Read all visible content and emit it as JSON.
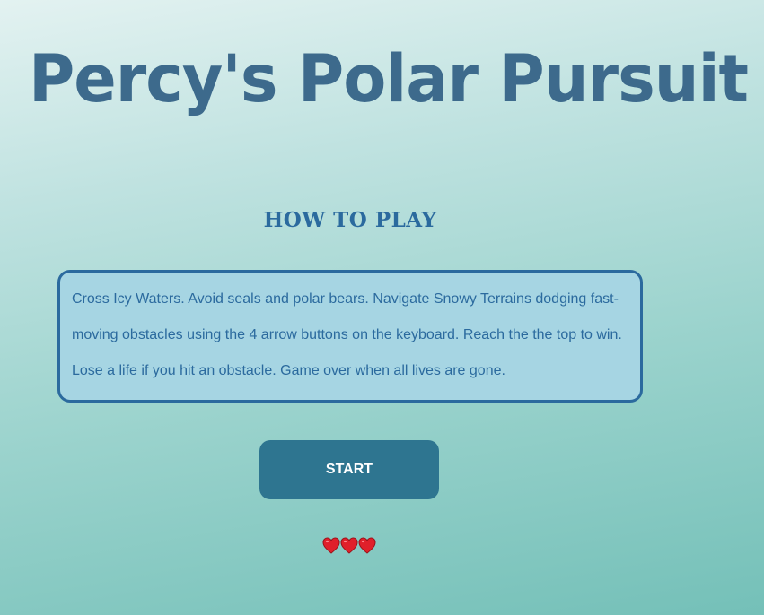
{
  "game": {
    "title": "Percy's Polar Pursuit"
  },
  "instructions": {
    "heading": "HOW TO PLAY",
    "text": "Cross Icy Waters. Avoid seals and polar bears. Navigate Snowy Terrains dodging fast-moving obstacles using the 4 arrow buttons on the keyboard. Reach the the top to win. Lose a life if you hit an obstacle. Game over when all lives are gone."
  },
  "start_button": {
    "label": "START"
  },
  "lives": {
    "count": 3,
    "icon": "heart-icon",
    "color": "#e0202a"
  },
  "colors": {
    "title": "#3d6a8c",
    "accent": "#2b6a9e",
    "box_background": "#a6d5e3",
    "button_background": "#2e7590"
  }
}
